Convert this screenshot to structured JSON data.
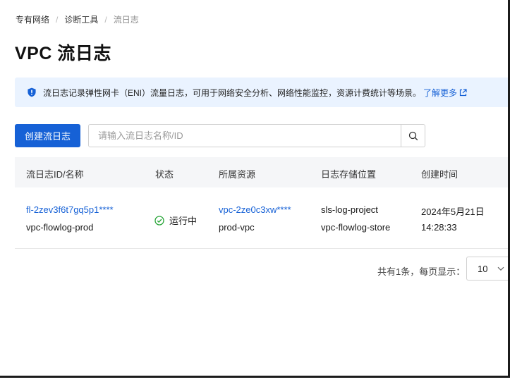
{
  "breadcrumb": {
    "items": [
      "专有网络",
      "诊断工具",
      "流日志"
    ],
    "separator": "/"
  },
  "page": {
    "title": "VPC 流日志"
  },
  "notice": {
    "text": "流日志记录弹性网卡（ENI）流量日志，可用于网络安全分析、网络性能监控，资源计费统计等场景。",
    "link_label": "了解更多",
    "icon": "shield-icon",
    "link_icon": "external-link-icon"
  },
  "toolbar": {
    "create_label": "创建流日志",
    "search_placeholder": "请输入流日志名称/ID",
    "search_icon": "search-icon"
  },
  "table": {
    "columns": [
      "流日志ID/名称",
      "状态",
      "所属资源",
      "日志存储位置",
      "创建时间"
    ],
    "rows": [
      {
        "id": "fl-2zev3f6t7gq5p1****",
        "name": "vpc-flowlog-prod",
        "status": "运行中",
        "resource_id": "vpc-2ze0c3xw****",
        "resource_name": "prod-vpc",
        "project": "sls-log-project",
        "logstore": "vpc-flowlog-store",
        "created_date": "2024年5月21日",
        "created_time": "14:28:33"
      }
    ]
  },
  "pagination": {
    "summary": "共有1条，每页显示：",
    "page_size": "10"
  },
  "colors": {
    "accent": "#1661d6",
    "notice_bg": "#eaf3ff",
    "success": "#2aa63a"
  }
}
